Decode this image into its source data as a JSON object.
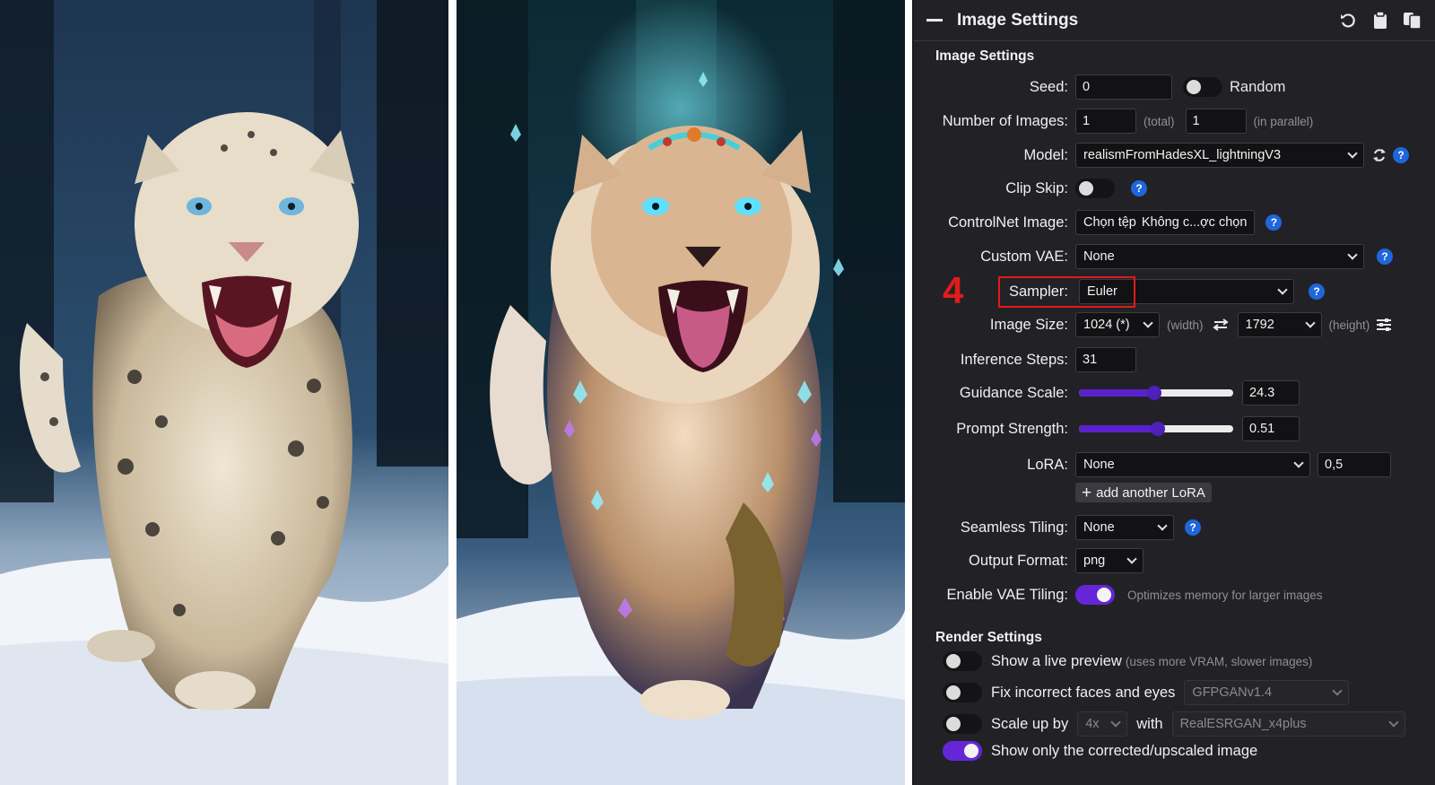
{
  "annotation": {
    "step_number": "4"
  },
  "panel": {
    "header_title": "Image Settings",
    "section_title": "Image Settings",
    "seed": {
      "label": "Seed:",
      "value": "0",
      "random_label": "Random",
      "random_on": false
    },
    "num_images": {
      "label": "Number of Images:",
      "total": "1",
      "total_suffix": "(total)",
      "parallel": "1",
      "parallel_suffix": "(in parallel)"
    },
    "model": {
      "label": "Model:",
      "value": "realismFromHadesXL_lightningV3"
    },
    "clip_skip": {
      "label": "Clip Skip:",
      "on": false
    },
    "controlnet": {
      "label": "ControlNet Image:",
      "button": "Chọn tệp",
      "file_status": "Không c...ợc chọn"
    },
    "custom_vae": {
      "label": "Custom VAE:",
      "value": "None"
    },
    "sampler": {
      "label": "Sampler:",
      "value": "Euler"
    },
    "image_size": {
      "label": "Image Size:",
      "width": "1024 (*)",
      "width_suffix": "(width)",
      "height": "1792",
      "height_suffix": "(height)"
    },
    "inference_steps": {
      "label": "Inference Steps:",
      "value": "31"
    },
    "guidance_scale": {
      "label": "Guidance Scale:",
      "value": "24.3",
      "fraction": 0.49
    },
    "prompt_strength": {
      "label": "Prompt Strength:",
      "value": "0.51",
      "fraction": 0.51
    },
    "lora": {
      "label": "LoRA:",
      "value": "None",
      "weight": "0,5",
      "add_label": "add another LoRA"
    },
    "seamless_tiling": {
      "label": "Seamless Tiling:",
      "value": "None"
    },
    "output_format": {
      "label": "Output Format:",
      "value": "png"
    },
    "vae_tiling": {
      "label": "Enable VAE Tiling:",
      "on": true,
      "note": "Optimizes memory for larger images"
    }
  },
  "render": {
    "section_title": "Render Settings",
    "live_preview": {
      "label": "Show a live preview",
      "note": "(uses more VRAM, slower images)",
      "on": false
    },
    "fix_faces": {
      "label": "Fix incorrect faces and eyes",
      "model": "GFPGANv1.4",
      "on": false
    },
    "scale_up": {
      "label": "Scale up by",
      "factor": "4x",
      "with_label": "with",
      "model": "RealESRGAN_x4plus",
      "on": false
    },
    "show_corrected": {
      "label": "Show only the corrected/upscaled image",
      "on": true
    }
  },
  "colors": {
    "accent": "#5a22cc",
    "help": "#1f66dc",
    "annotation_red": "#e01b1b",
    "panel_bg": "#222226"
  }
}
